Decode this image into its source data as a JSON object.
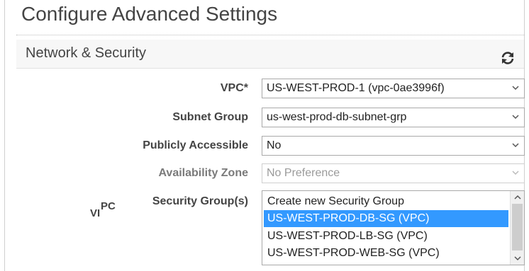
{
  "page": {
    "title": "Configure Advanced Settings"
  },
  "section": {
    "title": "Network & Security",
    "refresh_icon": "refresh-icon"
  },
  "fields": {
    "vpc": {
      "label": "VPC*",
      "value": "US-WEST-PROD-1 (vpc-0ae3996f)"
    },
    "subnet_group": {
      "label": "Subnet Group",
      "value": "us-west-prod-db-subnet-grp"
    },
    "publicly_accessible": {
      "label": "Publicly Accessible",
      "value": "No"
    },
    "availability_zone": {
      "label": "Availability Zone",
      "value": "No Preference"
    },
    "security_groups": {
      "label": "Security Group(s)",
      "ghost_label_1": "PC",
      "ghost_label_2": "VI",
      "options": [
        "Create new Security Group",
        "US-WEST-PROD-DB-SG (VPC)",
        "US-WEST-PROD-LB-SG (VPC)",
        "US-WEST-PROD-WEB-SG (VPC)"
      ],
      "selected_index": 1
    }
  },
  "colors": {
    "selection": "#3399ff",
    "refresh": "#333333"
  }
}
